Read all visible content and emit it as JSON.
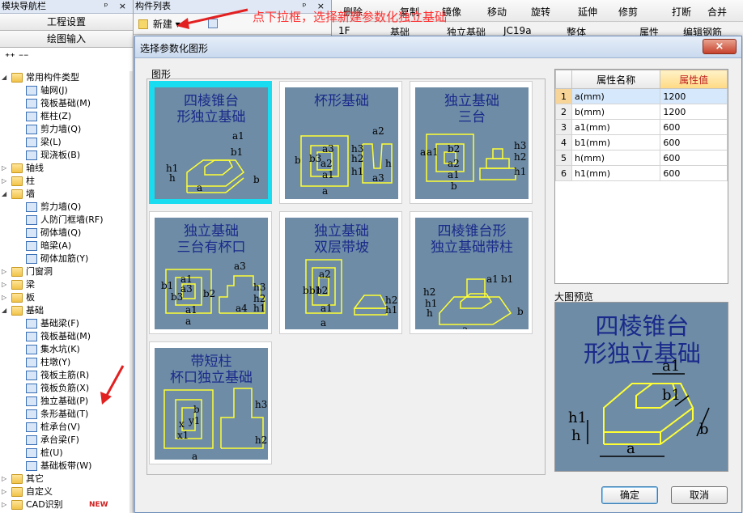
{
  "nav": {
    "title": "模块导航栏",
    "title_controls": "ᵖ × ",
    "btn_project": "工程设置",
    "btn_draw": "绘图输入",
    "tools": "⁺⁺ ⁻⁻",
    "tree": [
      {
        "level": 1,
        "expand": "◢",
        "icon": "folder",
        "label": "常用构件类型"
      },
      {
        "level": 2,
        "icon": "grid-icon",
        "label": "轴网(J)"
      },
      {
        "level": 2,
        "icon": "raft-icon",
        "label": "筏板基础(M)"
      },
      {
        "level": 2,
        "icon": "column-icon",
        "label": "框柱(Z)"
      },
      {
        "level": 2,
        "icon": "shear-wall-icon",
        "label": "剪力墙(Q)"
      },
      {
        "level": 2,
        "icon": "beam-icon",
        "label": "梁(L)"
      },
      {
        "level": 2,
        "icon": "slab-icon",
        "label": "现浇板(B)"
      },
      {
        "level": 1,
        "expand": "▷",
        "icon": "folder",
        "label": "轴线"
      },
      {
        "level": 1,
        "expand": "▷",
        "icon": "folder",
        "label": "柱"
      },
      {
        "level": 1,
        "expand": "◢",
        "icon": "folder",
        "label": "墙"
      },
      {
        "level": 2,
        "icon": "shear-wall-icon",
        "label": "剪力墙(Q)"
      },
      {
        "level": 2,
        "icon": "civil-defense-wall-icon",
        "label": "人防门框墙(RF)"
      },
      {
        "level": 2,
        "icon": "masonry-wall-icon",
        "label": "砌体墙(Q)"
      },
      {
        "level": 2,
        "icon": "hidden-beam-icon",
        "label": "暗梁(A)"
      },
      {
        "level": 2,
        "icon": "masonry-rebar-icon",
        "label": "砌体加筋(Y)"
      },
      {
        "level": 1,
        "expand": "▷",
        "icon": "folder",
        "label": "门窗洞"
      },
      {
        "level": 1,
        "expand": "▷",
        "icon": "folder",
        "label": "梁"
      },
      {
        "level": 1,
        "expand": "▷",
        "icon": "folder",
        "label": "板"
      },
      {
        "level": 1,
        "expand": "◢",
        "icon": "folder",
        "label": "基础"
      },
      {
        "level": 2,
        "icon": "foundation-beam-icon",
        "label": "基础梁(F)"
      },
      {
        "level": 2,
        "icon": "raft-icon",
        "label": "筏板基础(M)"
      },
      {
        "level": 2,
        "icon": "sump-icon",
        "label": "集水坑(K)"
      },
      {
        "level": 2,
        "icon": "column-pier-icon",
        "label": "柱墩(Y)"
      },
      {
        "level": 2,
        "icon": "raft-main-rebar-icon",
        "label": "筏板主筋(R)"
      },
      {
        "level": 2,
        "icon": "raft-neg-rebar-icon",
        "label": "筏板负筋(X)"
      },
      {
        "level": 2,
        "icon": "isolated-footing-icon",
        "label": "独立基础(P)"
      },
      {
        "level": 2,
        "icon": "strip-footing-icon",
        "label": "条形基础(T)"
      },
      {
        "level": 2,
        "icon": "pile-cap-icon",
        "label": "桩承台(V)"
      },
      {
        "level": 2,
        "icon": "cap-beam-icon",
        "label": "承台梁(F)"
      },
      {
        "level": 2,
        "icon": "pile-icon",
        "label": "桩(U)"
      },
      {
        "level": 2,
        "icon": "foundation-band-icon",
        "label": "基础板带(W)"
      },
      {
        "level": 1,
        "expand": "▷",
        "icon": "folder",
        "label": "其它"
      },
      {
        "level": 1,
        "expand": "▷",
        "icon": "folder",
        "label": "自定义"
      },
      {
        "level": 1,
        "expand": "▷",
        "icon": "folder",
        "label": "CAD识别",
        "badge": "NEW"
      }
    ]
  },
  "list": {
    "title": "构件列表",
    "title_controls": "ᵖ ×",
    "new_label": "新建",
    "new_dropdown": "▾"
  },
  "toolbar1": {
    "delete": "删除",
    "copy": "复制",
    "mirror": "镜像",
    "move": "移动",
    "rotate": "旋转",
    "extend": "延伸",
    "trim": "修剪",
    "break": "打断",
    "merge": "合并"
  },
  "toolbar2": {
    "floor": "1F",
    "category": "基础",
    "type": "独立基础",
    "name": "JC19a",
    "mode": "整体",
    "property": "属性",
    "edit_rebar": "编辑钢筋"
  },
  "annotation": "点下拉框，选择新建参数化独立基础",
  "dialog": {
    "title": "选择参数化图形",
    "close": "×",
    "group_label": "图形",
    "shapes": [
      {
        "id": "s1",
        "caption": [
          "四棱锥台",
          "形独立基础"
        ],
        "selected": true
      },
      {
        "id": "s2",
        "caption": [
          "杯形基础"
        ],
        "selected": false
      },
      {
        "id": "s3",
        "caption": [
          "独立基础",
          "三台"
        ],
        "selected": false
      },
      {
        "id": "s4",
        "caption": [
          "独立基础",
          "三台有杯口"
        ],
        "selected": false
      },
      {
        "id": "s5",
        "caption": [
          "独立基础",
          "双层带坡"
        ],
        "selected": false
      },
      {
        "id": "s6",
        "caption": [
          "四棱锥台形",
          "独立基础带柱"
        ],
        "selected": false
      },
      {
        "id": "s7",
        "caption": [
          "带短柱",
          "杯口独立基础"
        ],
        "selected": false
      }
    ],
    "prop_header": {
      "name": "属性名称",
      "value": "属性值"
    },
    "props": [
      {
        "no": "1",
        "name": "a(mm)",
        "value": "1200"
      },
      {
        "no": "2",
        "name": "b(mm)",
        "value": "1200"
      },
      {
        "no": "3",
        "name": "a1(mm)",
        "value": "600"
      },
      {
        "no": "4",
        "name": "b1(mm)",
        "value": "600"
      },
      {
        "no": "5",
        "name": "h(mm)",
        "value": "600"
      },
      {
        "no": "6",
        "name": "h1(mm)",
        "value": "600"
      }
    ],
    "preview_label": "大图预览",
    "preview_caption": [
      "四棱锥台",
      "形独立基础"
    ],
    "dims": {
      "a": "a",
      "b": "b",
      "a1": "a1",
      "b1": "b1",
      "h": "h",
      "h1": "h1",
      "a2": "a2",
      "a3": "a3",
      "b2": "b2",
      "b3": "b3",
      "h2": "h2",
      "h3": "h3",
      "a4": "a4",
      "x": "x",
      "x1": "x1",
      "y1": "y1"
    },
    "ok": "确定",
    "cancel": "取消"
  }
}
